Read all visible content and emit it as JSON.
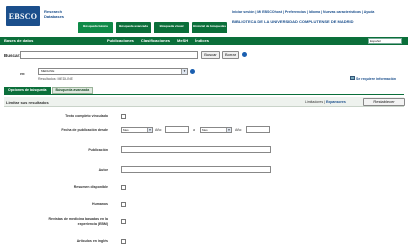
{
  "header": {
    "logo": "EBSCO",
    "logo_sub_1": "Research",
    "logo_sub_2": "Databases",
    "tabs": [
      {
        "label": "Búsqueda básica"
      },
      {
        "label": "Búsqueda avanzada"
      },
      {
        "label": "Búsqueda visual"
      },
      {
        "label": "Historial de búsquedas"
      }
    ],
    "top_links": "Iniciar sesión | Mi EBSCOhost | Preferencias | Idioma | Nuevas características | Ayuda",
    "institution": "BIBLIOTECA DE LA UNIVERSIDAD COMPLUTENSE DE MADRID"
  },
  "greenbar": {
    "left_label": "Bases de datos",
    "links": [
      "Publicaciones",
      "Clasificaciones",
      "MeSH",
      "Índices"
    ],
    "language_select": "Español"
  },
  "search": {
    "label": "Buscar:",
    "input_value": "",
    "search_button": "Buscar",
    "clear_button": "Borrar"
  },
  "database": {
    "label": "en:",
    "selected": "MEDLINE",
    "info": "Resultados: MEDLINE",
    "right_link": "Se requiere información"
  },
  "subtabs": [
    "Opciones de búsqueda",
    "Búsqueda avanzada"
  ],
  "limiters": {
    "title": "Limitar sus resultados",
    "prefs_text": "Limitadores |",
    "prefs_link": "Expansores",
    "reset_button": "Restablecer",
    "fields": [
      {
        "label": "Texto completo vinculado"
      },
      {
        "label": "Fecha de publicación desde"
      },
      {
        "label": "Publicación"
      },
      {
        "label": "Autor"
      },
      {
        "label": "Resumen disponible"
      },
      {
        "label": "Humanos"
      },
      {
        "label": "Revistas de medicina basadas en la experiencia (EBM)"
      },
      {
        "label": "Artículos en inglés"
      }
    ],
    "date_from_month": "Mes",
    "date_to_month": "Mes",
    "year_label": "Año:",
    "to_label": "a"
  },
  "colors": {
    "brand_blue": "#1b4f8c",
    "ebsco_green": "#0b6f3a"
  }
}
